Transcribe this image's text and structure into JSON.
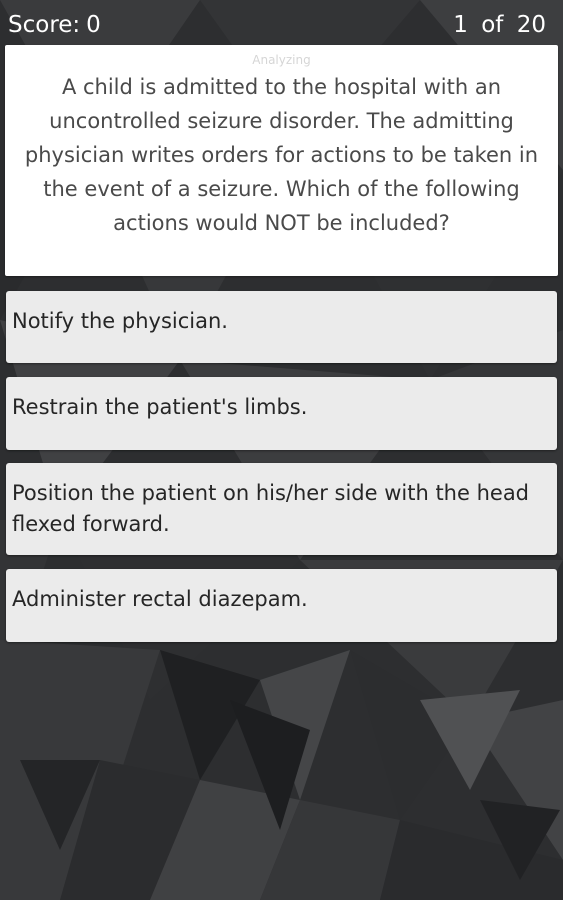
{
  "header": {
    "score_label": "Score:",
    "score_value": "0",
    "current": "1",
    "of_word": "of",
    "total": "20"
  },
  "question": {
    "category": "Analyzing",
    "text": "A child is admitted to the hospital with an uncontrolled seizure disorder. The admitting physician writes orders for actions to be taken in the event of a seizure. Which of the following actions would NOT be included?"
  },
  "answers": [
    {
      "label": "Notify the physician."
    },
    {
      "label": "Restrain the patient's limbs."
    },
    {
      "label": "Position the patient on his/her side with the head flexed forward."
    },
    {
      "label": "Administer rectal diazepam."
    }
  ],
  "colors": {
    "background": "#2b2c2e",
    "card": "#ffffff",
    "answer_bg": "#ebebeb",
    "header_text": "#ffffff",
    "question_text": "#4a4a4a"
  }
}
